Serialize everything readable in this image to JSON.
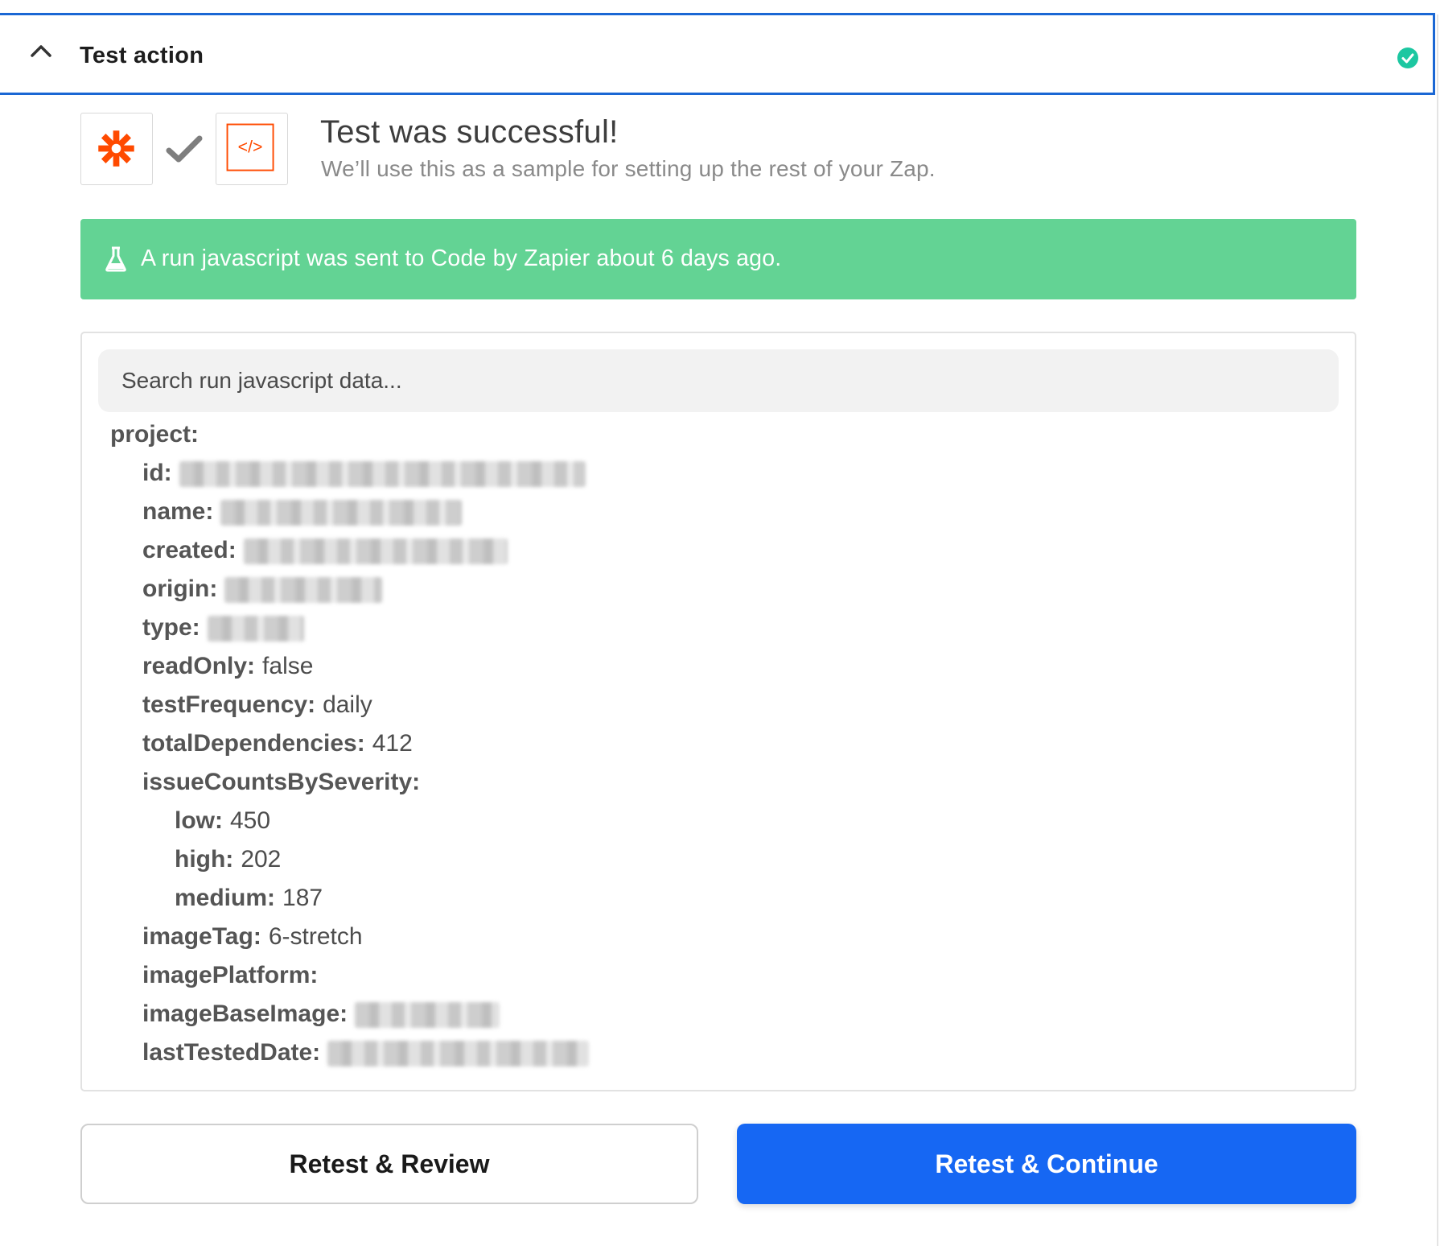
{
  "header": {
    "title": "Test action",
    "status_icon": "check-circle-icon",
    "status_color": "#1cc7a1",
    "accent_color": "#1a67d4"
  },
  "success": {
    "title": "Test was successful!",
    "subtitle": "We’ll use this as a sample for setting up the rest of your Zap.",
    "zapier_icon": "zapier-asterisk-icon",
    "code_icon": "code-brackets-icon",
    "code_icon_text": "</>",
    "icon_color": "#ff4a00"
  },
  "banner": {
    "text": "A run javascript was sent to Code by Zapier about 6 days ago.",
    "color": "#63d394",
    "icon": "flask-icon"
  },
  "search": {
    "placeholder": "Search run javascript data..."
  },
  "data_tree": {
    "root_key": "project:",
    "fields": [
      {
        "key": "id:",
        "value": "",
        "redacted": true
      },
      {
        "key": "name:",
        "value": "",
        "redacted": true
      },
      {
        "key": "created:",
        "value": "",
        "redacted": true
      },
      {
        "key": "origin:",
        "value": "",
        "redacted": true
      },
      {
        "key": "type:",
        "value": "",
        "redacted": true
      },
      {
        "key": "readOnly:",
        "value": "false"
      },
      {
        "key": "testFrequency:",
        "value": "daily"
      },
      {
        "key": "totalDependencies:",
        "value": "412"
      },
      {
        "key": "issueCountsBySeverity:",
        "value": ""
      },
      {
        "key": "low:",
        "value": "450"
      },
      {
        "key": "high:",
        "value": "202"
      },
      {
        "key": "medium:",
        "value": "187"
      },
      {
        "key": "imageTag:",
        "value": "6-stretch"
      },
      {
        "key": "imagePlatform:",
        "value": ""
      },
      {
        "key": "imageBaseImage:",
        "value": "",
        "redacted": true
      },
      {
        "key": "lastTestedDate:",
        "value": "",
        "redacted": true
      }
    ]
  },
  "buttons": {
    "review_label": "Retest & Review",
    "continue_label": "Retest & Continue",
    "continue_color": "#1667f3"
  }
}
